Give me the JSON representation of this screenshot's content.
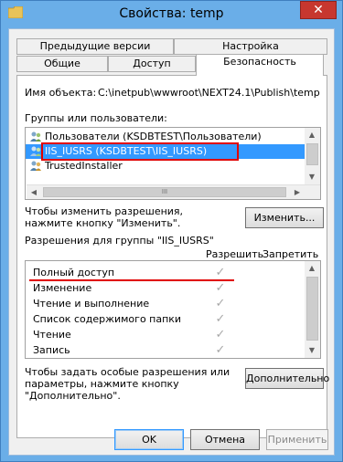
{
  "window": {
    "title": "Свойства: temp",
    "close_glyph": "✕"
  },
  "tabs": {
    "row1": [
      "Предыдущие версии",
      "Настройка"
    ],
    "row2": [
      "Общие",
      "Доступ",
      "Безопасность"
    ]
  },
  "object": {
    "label": "Имя объекта:",
    "path": "C:\\inetpub\\wwwroot\\NEXT24.1\\Publish\\temp"
  },
  "groups": {
    "label": "Группы или пользователи:",
    "items": [
      "Пользователи (KSDBTEST\\Пользователи)",
      "IIS_IUSRS (KSDBTEST\\IIS_IUSRS)",
      "TrustedInstaller"
    ],
    "selected_index": 1,
    "scroll_thumb_glyph": "III"
  },
  "change": {
    "hint": "Чтобы изменить разрешения,\nнажмите кнопку \"Изменить\".",
    "hint_line1": "Чтобы изменить разрешения,",
    "hint_line2": "нажмите кнопку \"Изменить\".",
    "button": "Изменить..."
  },
  "permissions": {
    "label": "Разрешения для группы \"IIS_IUSRS\"",
    "col_allow": "Разрешить",
    "col_deny": "Запретить",
    "rows": [
      {
        "name": "Полный доступ",
        "allow": true,
        "deny": false
      },
      {
        "name": "Изменение",
        "allow": true,
        "deny": false
      },
      {
        "name": "Чтение и выполнение",
        "allow": true,
        "deny": false
      },
      {
        "name": "Список содержимого папки",
        "allow": true,
        "deny": false
      },
      {
        "name": "Чтение",
        "allow": true,
        "deny": false
      },
      {
        "name": "Запись",
        "allow": true,
        "deny": false
      }
    ],
    "check_glyph": "✓"
  },
  "advanced": {
    "hint_line1": "Чтобы задать особые разрешения или",
    "hint_line2": "параметры, нажмите кнопку",
    "hint_line3": "\"Дополнительно\".",
    "button": "Дополнительно"
  },
  "footer": {
    "ok": "OK",
    "cancel": "Отмена",
    "apply": "Применить"
  },
  "colors": {
    "highlight_box": "#e00000",
    "underline": "#e00000",
    "selection": "#3399ff"
  }
}
